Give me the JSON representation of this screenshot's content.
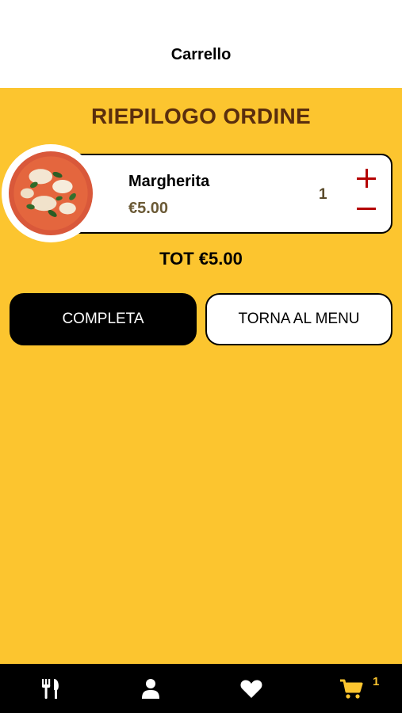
{
  "header": {
    "title": "Carrello"
  },
  "summary": {
    "title": "RIEPILOGO ORDINE"
  },
  "cart": {
    "items": [
      {
        "name": "Margherita",
        "price": "€5.00",
        "quantity": "1"
      }
    ],
    "total_label": "TOT €5.00"
  },
  "actions": {
    "complete_label": "COMPLETA",
    "back_label": "TORNA AL MENU"
  },
  "tabbar": {
    "items": [
      {
        "icon": "fork-knife-icon"
      },
      {
        "icon": "user-icon"
      },
      {
        "icon": "heart-icon"
      },
      {
        "icon": "cart-icon"
      }
    ],
    "cart_badge": "1"
  },
  "colors": {
    "background": "#FCC52F",
    "title": "#5A2E0E",
    "accent_red": "#B40000",
    "tab_bar": "#000000",
    "active_tab": "#FCC52F"
  }
}
